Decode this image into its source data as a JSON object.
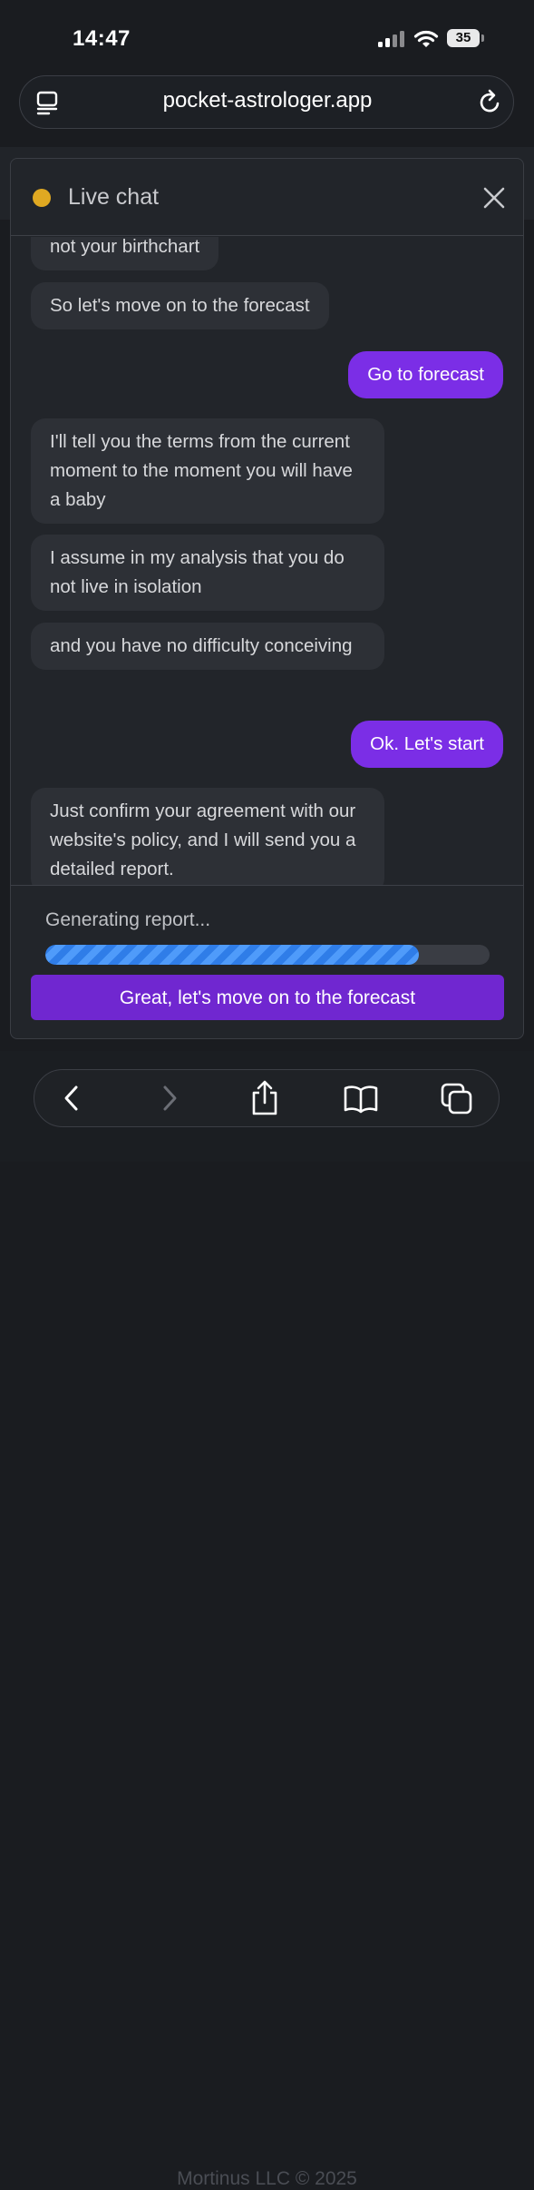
{
  "status_bar": {
    "time": "14:47",
    "battery": "35"
  },
  "browser": {
    "url": "pocket-astrologer.app"
  },
  "chat": {
    "title": "Live chat",
    "status_color": "#e0a922",
    "messages": [
      {
        "from": "bot",
        "text": "not your birthchart"
      },
      {
        "from": "bot",
        "text": "So let's move on to the forecast"
      },
      {
        "from": "user",
        "text": "Go to forecast"
      },
      {
        "from": "bot",
        "text": "I'll tell you the terms from the current moment to the moment you will have a baby"
      },
      {
        "from": "bot",
        "text": "I assume in my analysis that you do not live in isolation"
      },
      {
        "from": "bot",
        "text": "and you have no difficulty conceiving"
      },
      {
        "from": "user",
        "text": "Ok. Let's start"
      },
      {
        "from": "bot",
        "text": "Just confirm your agreement with our website's policy, and I will send you a detailed report."
      }
    ],
    "progress_label": "Generating report...",
    "progress_fraction": 0.84,
    "cta_label": "Great, let's move on to the forecast"
  },
  "footer": {
    "text": "Mortinus LLC © 2025"
  },
  "colors": {
    "accent": "#7b2ee6",
    "progress": "#2f7de8"
  }
}
